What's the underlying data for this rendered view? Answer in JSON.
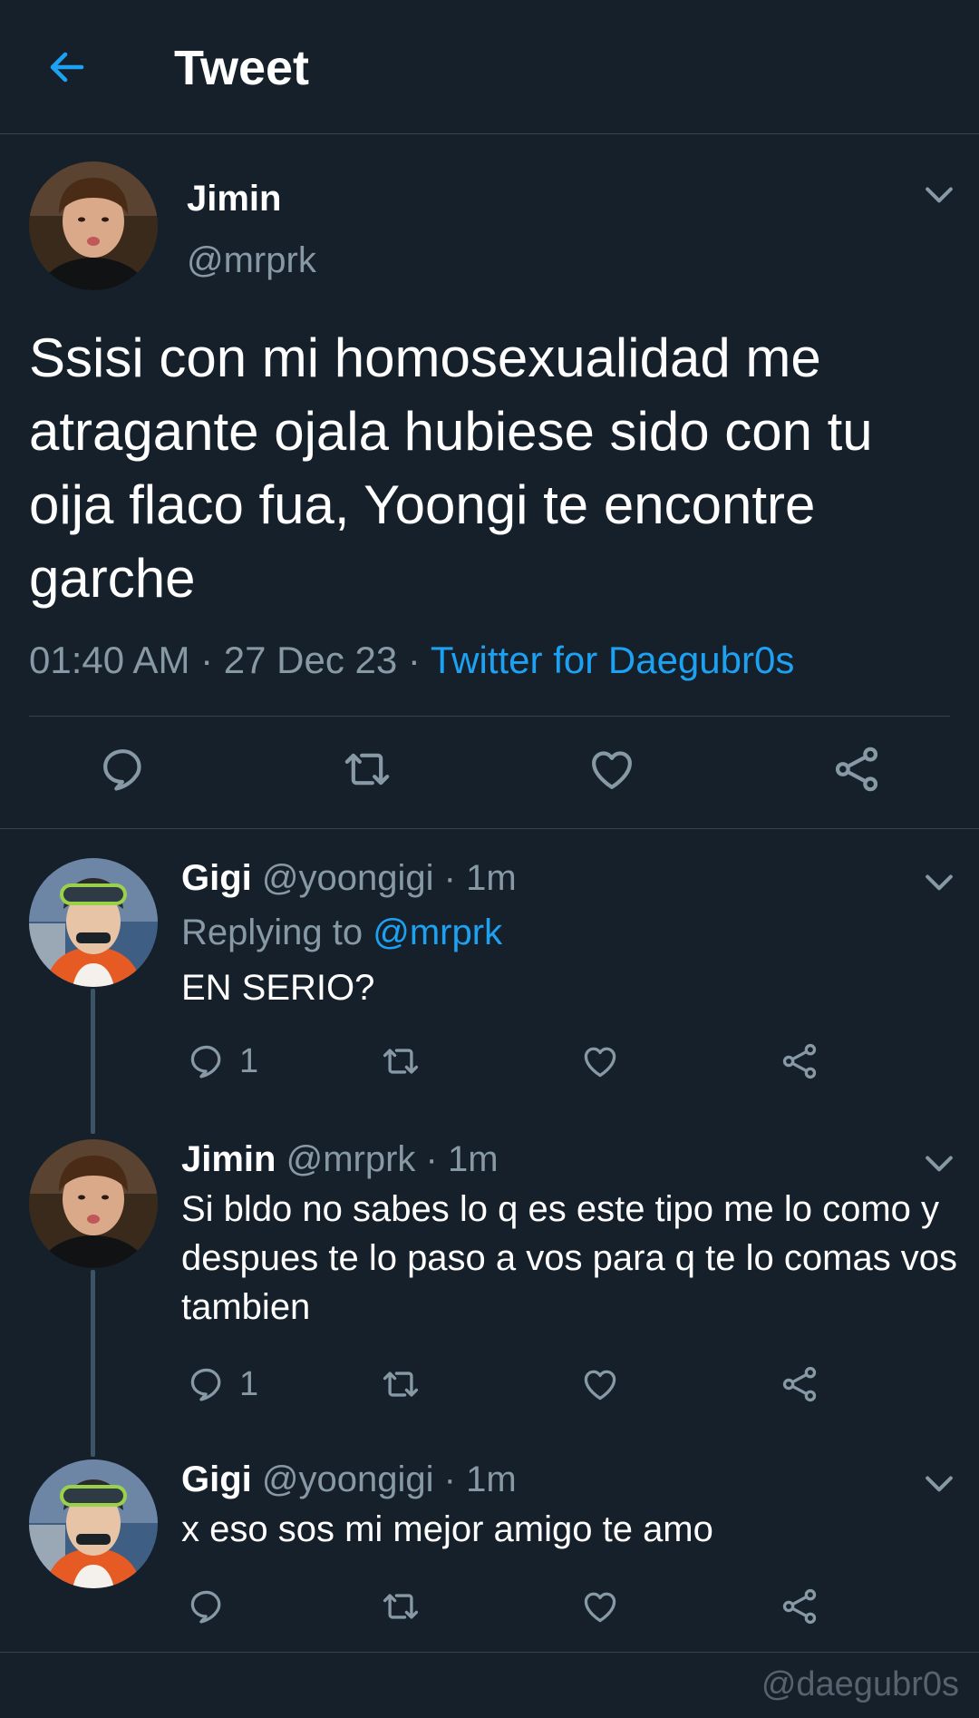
{
  "header": {
    "title": "Tweet",
    "back_icon": "arrow-left-icon"
  },
  "main_tweet": {
    "name": "Jimin",
    "handle": "@mrprk",
    "text": "Ssisi con mi homosexualidad me atragante ojala hubiese sido con tu oija flaco fua, Yoongi te encontre garche",
    "time": "01:40 AM",
    "date": "27 Dec 23",
    "separator": " · ",
    "source": "Twitter for Daegubr0s"
  },
  "replies": [
    {
      "name": "Gigi",
      "handle": "@yoongigi",
      "time": "1m",
      "replying_label": "Replying to",
      "replying_to": "@mrprk",
      "text": "EN SERIO?",
      "reply_count": "1"
    },
    {
      "name": "Jimin",
      "handle": "@mrprk",
      "time": "1m",
      "text": "Si bldo no sabes lo q es este tipo me lo como y despues te lo paso a vos para q te lo comas vos tambien",
      "reply_count": "1"
    },
    {
      "name": "Gigi",
      "handle": "@yoongigi",
      "time": "1m",
      "text": "x eso sos mi mejor amigo te amo",
      "reply_count": ""
    }
  ],
  "watermark": "@daegubr0s",
  "colors": {
    "background": "#15202b",
    "accent": "#1da1f2",
    "secondary_text": "#8899a6",
    "divider": "#38444d"
  }
}
